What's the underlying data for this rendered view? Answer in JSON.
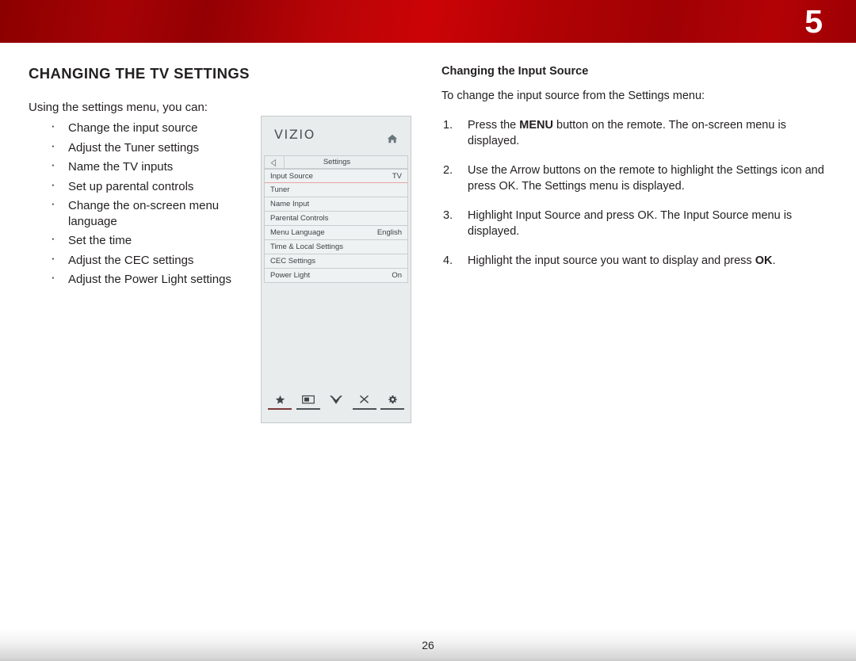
{
  "header": {
    "chapter_number": "5",
    "accent_color": "#b00205"
  },
  "footer": {
    "page_number": "26"
  },
  "left_column": {
    "section_title": "CHANGING THE TV SETTINGS",
    "intro": "Using the settings menu, you can:",
    "bullets": [
      "Change the input source",
      "Adjust the Tuner settings",
      "Name the TV inputs",
      "Set up parental controls",
      "Change the on-screen menu language",
      "Set the time",
      "Adjust the CEC settings",
      "Adjust the Power Light settings"
    ]
  },
  "tv_menu": {
    "brand": "VIZIO",
    "home_icon": "home-icon",
    "back_icon": "back-arrow-icon",
    "menu_title": "Settings",
    "highlight_color": "#e8a3a6",
    "rows": [
      {
        "label": "Input Source",
        "value": "TV",
        "highlighted": true
      },
      {
        "label": "Tuner",
        "value": "",
        "highlighted": false
      },
      {
        "label": "Name Input",
        "value": "",
        "highlighted": false
      },
      {
        "label": "Parental Controls",
        "value": "",
        "highlighted": false
      },
      {
        "label": "Menu Language",
        "value": "English",
        "highlighted": false
      },
      {
        "label": "Time & Local Settings",
        "value": "",
        "highlighted": false
      },
      {
        "label": "CEC Settings",
        "value": "",
        "highlighted": false
      },
      {
        "label": "Power Light",
        "value": "On",
        "highlighted": false
      }
    ],
    "bottom_icons": [
      {
        "name": "star-icon",
        "glyph": "★"
      },
      {
        "name": "wide-picture-icon",
        "glyph": ""
      },
      {
        "name": "chevron-double-down-icon",
        "glyph": ""
      },
      {
        "name": "close-x-icon",
        "glyph": "✕"
      },
      {
        "name": "gear-icon",
        "glyph": ""
      }
    ]
  },
  "right_column": {
    "sub_title": "Changing the Input Source",
    "lead": "To change the input source from the Settings menu:",
    "steps": [
      {
        "number": "1.",
        "before": "Press the ",
        "bold": "MENU",
        "after": " button on the remote. The on-screen menu is displayed."
      },
      {
        "number": "2.",
        "before": "Use the Arrow buttons on the remote to highlight the Settings icon and press OK. The Settings menu is displayed.",
        "bold": "",
        "after": ""
      },
      {
        "number": "3.",
        "before": "Highlight Input Source and press OK. The Input Source menu is displayed.",
        "bold": "",
        "after": ""
      },
      {
        "number": "4.",
        "before": "Highlight the input source you want to display and press ",
        "bold": "OK",
        "after": "."
      }
    ]
  }
}
